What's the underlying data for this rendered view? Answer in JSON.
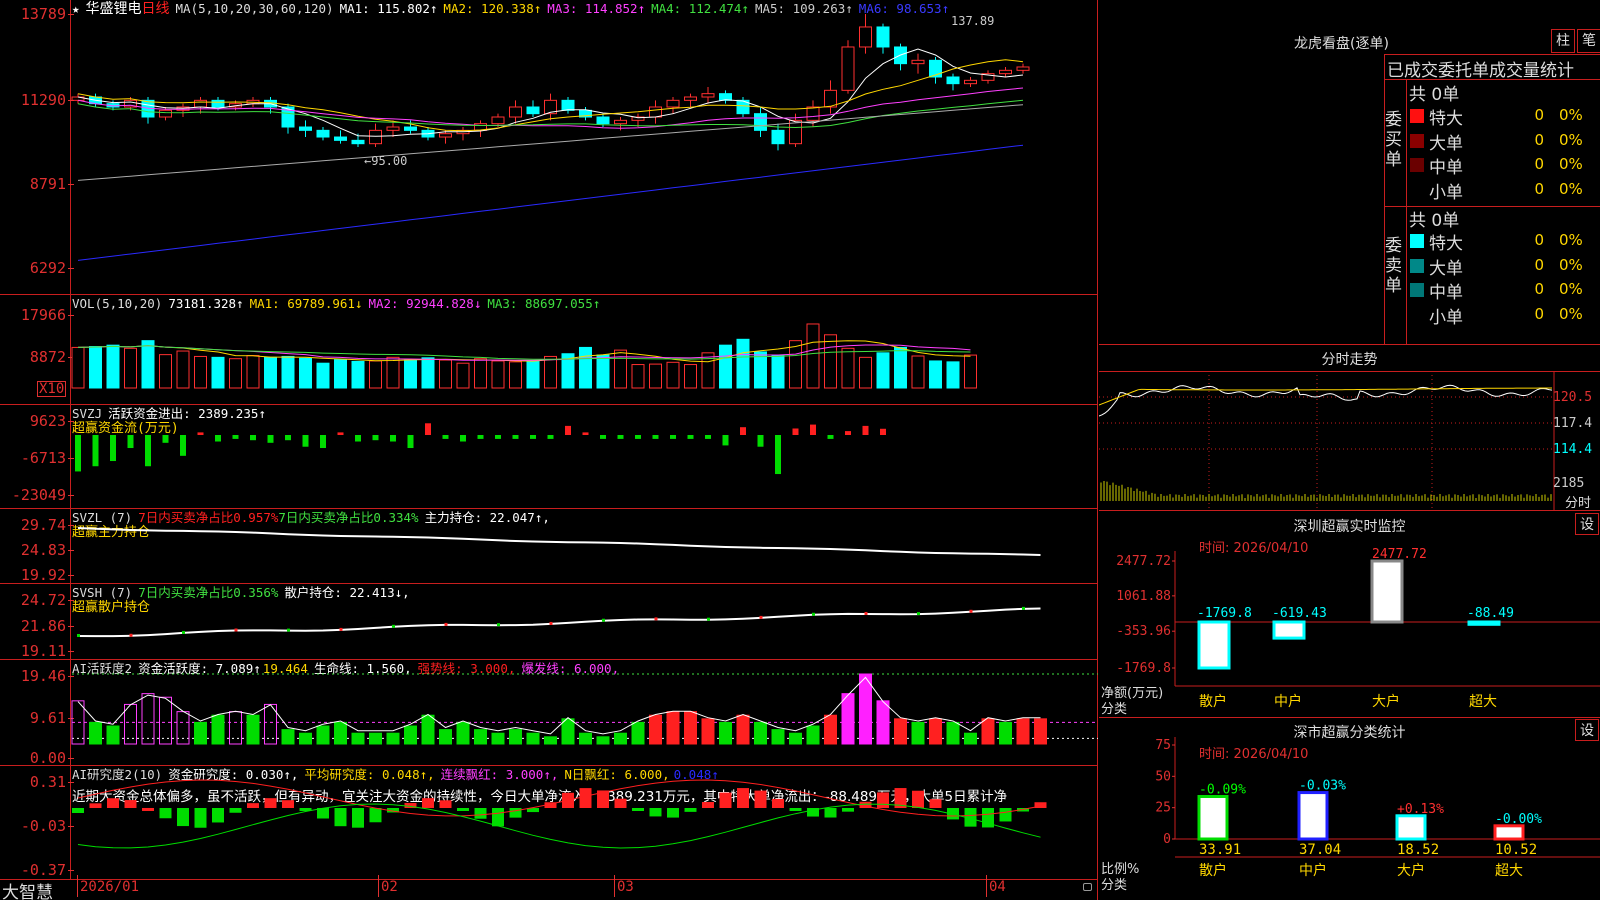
{
  "stock": {
    "star": "★",
    "name": "华盛锂电",
    "period": "日线"
  },
  "main": {
    "ma_header": "MA(5,10,20,30,60,120)",
    "ma": [
      {
        "label": "MA1: 115.802↑",
        "color": "#ffffff"
      },
      {
        "label": "MA2: 120.338↑",
        "color": "#ffd700"
      },
      {
        "label": "MA3: 114.852↑",
        "color": "#ff40ff"
      },
      {
        "label": "MA4: 112.474↑",
        "color": "#40e040"
      },
      {
        "label": "MA5: 109.263↑",
        "color": "#aaaaaa"
      },
      {
        "label": "MA6: 98.653↑",
        "color": "#2a2aff"
      }
    ],
    "y_ticks": [
      "13789",
      "11290",
      "8791",
      "6292"
    ],
    "high_label": "137.89",
    "low_label": "←95.00"
  },
  "vol": {
    "header": "VOL(5,10,20)",
    "value": "73181.328↑",
    "ma": [
      {
        "label": "MA1: 69789.961↓",
        "color": "#ffd700"
      },
      {
        "label": "MA2: 92944.828↓",
        "color": "#ff40ff"
      },
      {
        "label": "MA3: 88697.055↑",
        "color": "#40e040"
      }
    ],
    "y_ticks": [
      "17966",
      "8872"
    ],
    "unit": "X10"
  },
  "svzj": {
    "header": "SVZJ",
    "label": "活跃资金进出: 2389.235↑",
    "sub": "超赢资金流(万元)",
    "y_ticks": [
      "9623",
      "-6713",
      "-23049"
    ]
  },
  "svzl": {
    "header": "SVZL (7)",
    "t1": "7日内买卖净占比0.957%",
    "t2": "7日内买卖净占比0.334%",
    "t3": "主力持仓: 22.047↑,",
    "sub": "超赢主力持仓",
    "y_ticks": [
      "29.74",
      "24.83",
      "19.92"
    ]
  },
  "svsh": {
    "header": "SVSH (7)",
    "t1": "7日内买卖净占比0.356%",
    "t2": "散户持仓: 22.413↓,",
    "sub": "超赢散户持仓",
    "y_ticks": [
      "24.72",
      "21.86",
      "19.11"
    ]
  },
  "ai1": {
    "header": "AI活跃度2",
    "t1": "资金活跃度: 7.089↑",
    "t2": "19.464",
    "t3": "生命线: 1.560,",
    "t4": "强势线: 3.000,",
    "t5": "爆发线: 6.000,",
    "y_ticks": [
      "19.46",
      "9.61",
      "0.00"
    ]
  },
  "ai2": {
    "header": "AI研究度2(10)",
    "t1": "资金研究度: 0.030↑,",
    "t2": "平均研究度: 0.048↑,",
    "t3": "连续飘红: 3.000↑,",
    "t4": "N日飘红: 6.000,",
    "t5": "0.048↑",
    "comment": "近期大资金总体偏多，虽不活跃，但有异动，宜关注大资金的持续性，今日大单净流入：2389.231万元，其中特大单净流出：-88.489万元，大单5日累计净",
    "y_ticks": [
      "0.31",
      "-0.03",
      "-0.37"
    ]
  },
  "xaxis": {
    "labels": [
      "2026/01",
      "02",
      "03",
      "04"
    ]
  },
  "brand": "大智慧",
  "longhu": {
    "title": "龙虎看盘(逐单)",
    "btn1": "柱",
    "btn2": "笔",
    "subtitle": "已成交委托单成交量统计",
    "buy_side": "委买单",
    "sell_side": "委卖单",
    "total_buy": "共 0单",
    "total_sell": "共 0单",
    "buy_rows": [
      {
        "label": "特大",
        "color": "#ff1010",
        "v": "0",
        "p": "0%"
      },
      {
        "label": "大单",
        "color": "#8a0000",
        "v": "0",
        "p": "0%"
      },
      {
        "label": "中单",
        "color": "#6a0000",
        "v": "0",
        "p": "0%"
      },
      {
        "label": "小单",
        "color": "#000000",
        "v": "0",
        "p": "0%"
      }
    ],
    "sell_rows": [
      {
        "label": "特大",
        "color": "#00ffff",
        "v": "0",
        "p": "0%"
      },
      {
        "label": "大单",
        "color": "#008888",
        "v": "0",
        "p": "0%"
      },
      {
        "label": "中单",
        "color": "#007777",
        "v": "0",
        "p": "0%"
      },
      {
        "label": "小单",
        "color": "#000000",
        "v": "0",
        "p": "0%"
      }
    ]
  },
  "intraday": {
    "title": "分时走势",
    "y_labels": [
      "120.5",
      "117.4",
      "114.4",
      "2185"
    ],
    "unit": "分时"
  },
  "sz_monitor": {
    "title": "深圳超赢实时监控",
    "btn": "设",
    "date": "时间: 2026/04/10",
    "ylabel": "净额(万元)",
    "xlabel": "分类",
    "y_ticks": [
      "2477.72",
      "1061.88",
      "-353.96",
      "-1769.8"
    ],
    "categories": [
      "散户",
      "中户",
      "大户",
      "超大"
    ],
    "values": [
      -1769.8,
      -619.43,
      2477.72,
      -88.49
    ],
    "value_labels": [
      "-1769.8",
      "-619.43",
      "2477.72",
      "-88.49"
    ]
  },
  "sz_class": {
    "title": "深市超赢分类统计",
    "btn": "设",
    "date": "时间: 2026/04/10",
    "ylabel": "比例%",
    "xlabel": "分类",
    "y_ticks": [
      "75",
      "50",
      "25",
      "0"
    ],
    "categories": [
      "散户",
      "中户",
      "大户",
      "超大"
    ],
    "values": [
      33.91,
      37.04,
      18.52,
      10.52
    ],
    "changes": [
      "-0.09%",
      "-0.03%",
      "+0.13%",
      "-0.00%"
    ],
    "value_labels": [
      "33.91",
      "37.04",
      "18.52",
      "10.52"
    ]
  },
  "chart_data": [
    {
      "type": "candlestick",
      "title": "华盛锂电 日线",
      "y_range": [
        62.92,
        137.89
      ],
      "ohlc_approx": [
        [
          112,
          114,
          111,
          113
        ],
        [
          113,
          114,
          110,
          111
        ],
        [
          111,
          112,
          109,
          110
        ],
        [
          110,
          113,
          109,
          112
        ],
        [
          112,
          113,
          105,
          107
        ],
        [
          107,
          110,
          106,
          109
        ],
        [
          109,
          111,
          107,
          110
        ],
        [
          110,
          113,
          108,
          112
        ],
        [
          112,
          113,
          109,
          110
        ],
        [
          110,
          112,
          109,
          111
        ],
        [
          111,
          113,
          110,
          112
        ],
        [
          112,
          113,
          108,
          110
        ],
        [
          110,
          111,
          102,
          104
        ],
        [
          104,
          106,
          101,
          103
        ],
        [
          103,
          104,
          100,
          101
        ],
        [
          101,
          103,
          99,
          100
        ],
        [
          100,
          102,
          98,
          99
        ],
        [
          99,
          105,
          98,
          103
        ],
        [
          103,
          106,
          101,
          104
        ],
        [
          104,
          106,
          102,
          103
        ],
        [
          103,
          104,
          100,
          101
        ],
        [
          101,
          103,
          99,
          102
        ],
        [
          102,
          104,
          100,
          103
        ],
        [
          103,
          106,
          101,
          105
        ],
        [
          105,
          108,
          104,
          107
        ],
        [
          107,
          112,
          105,
          110
        ],
        [
          110,
          112,
          107,
          108
        ],
        [
          108,
          114,
          106,
          112
        ],
        [
          112,
          113,
          108,
          109
        ],
        [
          109,
          110,
          106,
          107
        ],
        [
          107,
          108,
          104,
          105
        ],
        [
          105,
          107,
          103,
          106
        ],
        [
          106,
          108,
          104,
          107
        ],
        [
          107,
          112,
          105,
          110
        ],
        [
          110,
          113,
          108,
          112
        ],
        [
          112,
          114,
          110,
          113
        ],
        [
          113,
          116,
          111,
          114
        ],
        [
          114,
          115,
          111,
          112
        ],
        [
          112,
          113,
          107,
          108
        ],
        [
          108,
          110,
          101,
          103
        ],
        [
          103,
          105,
          97,
          99
        ],
        [
          99,
          108,
          98,
          106
        ],
        [
          106,
          112,
          104,
          110
        ],
        [
          110,
          118,
          108,
          115
        ],
        [
          115,
          130,
          114,
          128
        ],
        [
          128,
          137.89,
          126,
          134
        ],
        [
          134,
          135,
          126,
          128
        ],
        [
          128,
          129,
          121,
          123
        ],
        [
          123,
          126,
          120,
          124
        ],
        [
          124,
          125,
          117,
          119
        ],
        [
          119,
          120,
          115,
          117
        ],
        [
          117,
          119,
          116,
          118
        ],
        [
          118,
          121,
          117,
          120
        ],
        [
          120,
          122,
          119,
          121
        ],
        [
          121,
          123,
          120,
          122
        ]
      ]
    },
    {
      "type": "bar",
      "title": "VOL(5,10,20)",
      "note": "volume x10",
      "approx_values": [
        9000,
        9200,
        9500,
        8800,
        10500,
        7400,
        8200,
        7000,
        6800,
        6500,
        7200,
        6800,
        7000,
        6600,
        5500,
        6300,
        5900,
        6000,
        6800,
        6200,
        6700,
        6200,
        5500,
        6500,
        6000,
        5800,
        6000,
        7000,
        7600,
        9000,
        7300,
        8400,
        5200,
        5300,
        5700,
        5200,
        7800,
        9500,
        10800,
        8000,
        7200,
        10500,
        14200,
        11800,
        8800,
        6800,
        7800,
        9000,
        7100,
        6000,
        5800,
        7300
      ]
    },
    {
      "type": "bar",
      "title": "活跃资金进出",
      "approx_values": [
        -14000,
        -12000,
        -10000,
        -5000,
        -12000,
        -3000,
        -8000,
        1000,
        -2500,
        -1500,
        -2000,
        -3000,
        -2000,
        -4500,
        -5000,
        1000,
        -2500,
        -2000,
        -2500,
        -5000,
        4500,
        -1500,
        -2500,
        -1500,
        -1500,
        -1500,
        -1500,
        -1500,
        3500,
        1000,
        -1500,
        -1500,
        -1500,
        -1500,
        -1500,
        -1500,
        -1500,
        -4000,
        3000,
        -4500,
        -15000,
        2500,
        4000,
        -1500,
        1500,
        3500,
        2389
      ]
    },
    {
      "type": "line",
      "title": "主力持仓",
      "y_range": [
        19.92,
        29.74
      ],
      "final": 22.047
    },
    {
      "type": "line",
      "title": "散户持仓",
      "y_range": [
        19.11,
        24.72
      ],
      "final": 22.413
    },
    {
      "type": "bar",
      "title": "AI活跃度2",
      "y_range": [
        0,
        19.46
      ],
      "final": 7.089
    },
    {
      "type": "bar",
      "title": "AI研究度2(10)",
      "y_range": [
        -0.37,
        0.31
      ],
      "final": 0.03
    },
    {
      "type": "bar",
      "title": "深圳超赢实时监控",
      "categories": [
        "散户",
        "中户",
        "大户",
        "超大"
      ],
      "values": [
        -1769.8,
        -619.43,
        2477.72,
        -88.49
      ]
    },
    {
      "type": "bar",
      "title": "深市超赢分类统计",
      "categories": [
        "散户",
        "中户",
        "大户",
        "超大"
      ],
      "values": [
        33.91,
        37.04,
        18.52,
        10.52
      ]
    }
  ]
}
